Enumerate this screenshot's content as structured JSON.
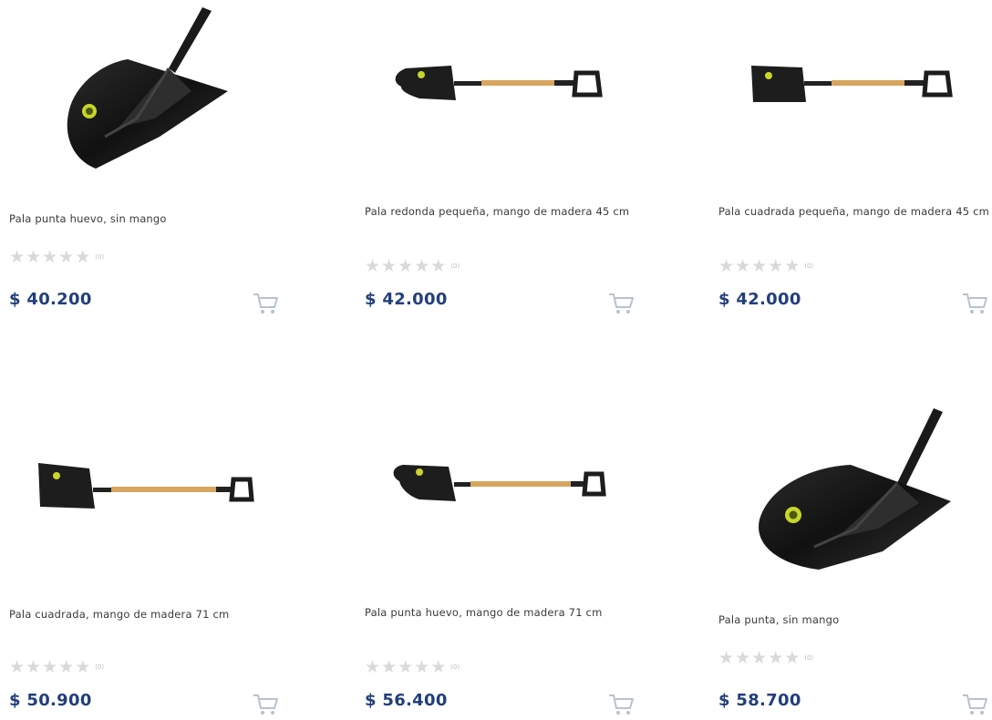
{
  "products": [
    {
      "title": "Pala punta huevo, sin mango",
      "rating_stars": 5,
      "rating_count": "(0)",
      "price": "$ 40.200",
      "image": "shovel-head-pointed-large",
      "icon": "cart-icon"
    },
    {
      "title": "Pala redonda pequeña, mango de madera 45 cm",
      "rating_stars": 5,
      "rating_count": "(0)",
      "price": "$ 42.000",
      "image": "shovel-round-small-d-handle",
      "icon": "cart-icon"
    },
    {
      "title": "Pala cuadrada pequeña, mango de madera 45 cm",
      "rating_stars": 5,
      "rating_count": "(0)",
      "price": "$ 42.000",
      "image": "shovel-square-small-d-handle",
      "icon": "cart-icon"
    },
    {
      "title": "Pala cuadrada, mango de madera 71 cm",
      "rating_stars": 5,
      "rating_count": "(0)",
      "price": "$ 50.900",
      "image": "shovel-square-long-handle",
      "icon": "cart-icon"
    },
    {
      "title": "Pala punta huevo, mango de madera 71 cm",
      "rating_stars": 5,
      "rating_count": "(0)",
      "price": "$ 56.400",
      "image": "shovel-pointed-long-handle",
      "icon": "cart-icon"
    },
    {
      "title": "Pala punta, sin mango",
      "rating_stars": 5,
      "rating_count": "(0)",
      "price": "$ 58.700",
      "image": "shovel-head-pointed-large",
      "icon": "cart-icon"
    }
  ],
  "colors": {
    "price": "#223f7b",
    "star_empty": "#d9d9d9",
    "title": "#3a3a3a",
    "cart": "#b8c2cc",
    "logo": "#d6e22a"
  }
}
